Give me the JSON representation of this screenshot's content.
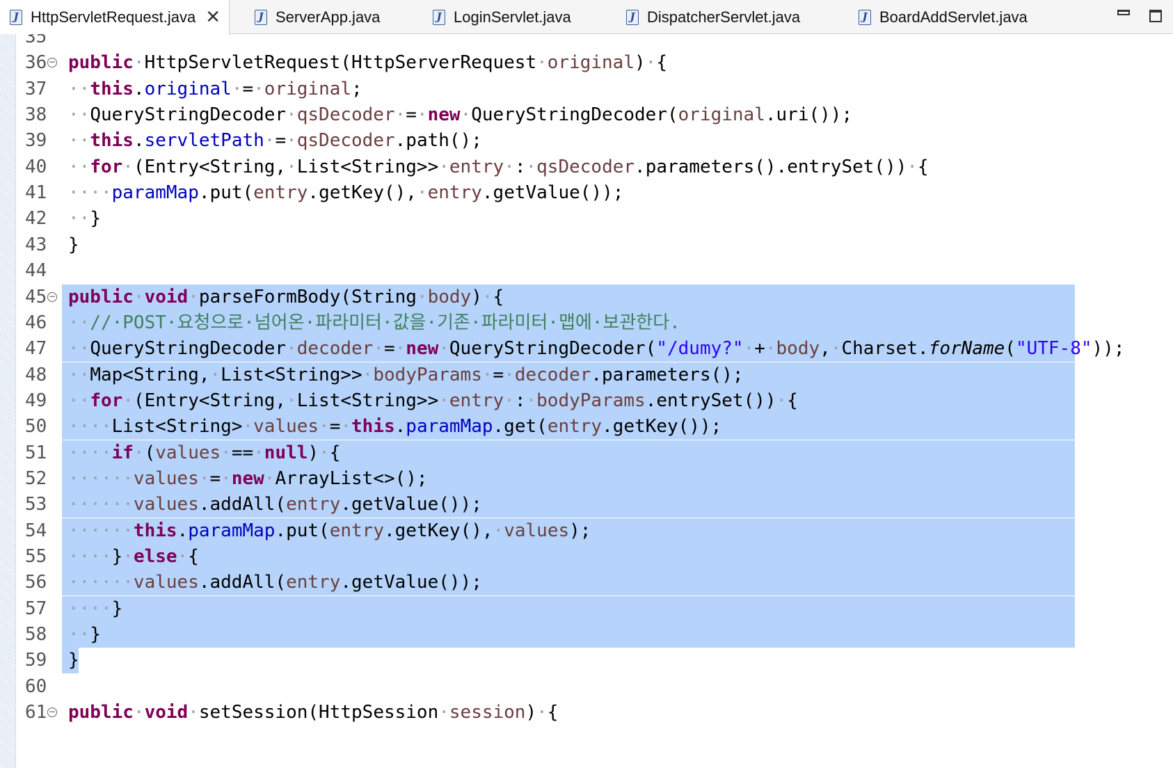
{
  "tabs": [
    {
      "label": "HttpServletRequest.java",
      "active": true
    },
    {
      "label": "ServerApp.java",
      "active": false
    },
    {
      "label": "LoginServlet.java",
      "active": false
    },
    {
      "label": "DispatcherServlet.java",
      "active": false
    },
    {
      "label": "BoardAddServlet.java",
      "active": false
    }
  ],
  "icons": {
    "tab_file": "java-file-icon",
    "tab_close": "close-icon",
    "window_minimize": "minimize-icon",
    "window_maximize": "maximize-icon",
    "fold": "fold-collapse-icon"
  },
  "colors": {
    "keyword": "#7f0055",
    "field": "#0000c0",
    "local_variable": "#6a3e3e",
    "string": "#2a00ff",
    "comment": "#3f7f5f",
    "selection": "#b6d4fb"
  },
  "editor": {
    "selected_lines": [
      45,
      59
    ],
    "lines": [
      {
        "num": "35",
        "tokens": []
      },
      {
        "num": "36",
        "fold": true,
        "tokens": [
          [
            "kw",
            "public"
          ],
          [
            "ws",
            "·"
          ],
          [
            "p",
            "HttpServletRequest(HttpServerRequest"
          ],
          [
            "ws",
            "·"
          ],
          [
            "var",
            "original"
          ],
          [
            "p",
            ")"
          ],
          [
            "ws",
            "·"
          ],
          [
            "p",
            "{"
          ]
        ]
      },
      {
        "num": "37",
        "tokens": [
          [
            "ws",
            "··"
          ],
          [
            "kw",
            "this"
          ],
          [
            "p",
            "."
          ],
          [
            "fld",
            "original"
          ],
          [
            "ws",
            "·"
          ],
          [
            "p",
            "="
          ],
          [
            "ws",
            "·"
          ],
          [
            "var",
            "original"
          ],
          [
            "p",
            ";"
          ]
        ]
      },
      {
        "num": "38",
        "tokens": [
          [
            "ws",
            "··"
          ],
          [
            "p",
            "QueryStringDecoder"
          ],
          [
            "ws",
            "·"
          ],
          [
            "var",
            "qsDecoder"
          ],
          [
            "ws",
            "·"
          ],
          [
            "p",
            "="
          ],
          [
            "ws",
            "·"
          ],
          [
            "kw",
            "new"
          ],
          [
            "ws",
            "·"
          ],
          [
            "p",
            "QueryStringDecoder("
          ],
          [
            "var",
            "original"
          ],
          [
            "p",
            ".uri());"
          ]
        ]
      },
      {
        "num": "39",
        "tokens": [
          [
            "ws",
            "··"
          ],
          [
            "kw",
            "this"
          ],
          [
            "p",
            "."
          ],
          [
            "fld",
            "servletPath"
          ],
          [
            "ws",
            "·"
          ],
          [
            "p",
            "="
          ],
          [
            "ws",
            "·"
          ],
          [
            "var",
            "qsDecoder"
          ],
          [
            "p",
            ".path();"
          ]
        ]
      },
      {
        "num": "40",
        "tokens": [
          [
            "ws",
            "··"
          ],
          [
            "kw",
            "for"
          ],
          [
            "ws",
            "·"
          ],
          [
            "p",
            "(Entry<String,"
          ],
          [
            "ws",
            "·"
          ],
          [
            "p",
            "List<String>>"
          ],
          [
            "ws",
            "·"
          ],
          [
            "var",
            "entry"
          ],
          [
            "ws",
            "·"
          ],
          [
            "p",
            ":"
          ],
          [
            "ws",
            "·"
          ],
          [
            "var",
            "qsDecoder"
          ],
          [
            "p",
            ".parameters().entrySet())"
          ],
          [
            "ws",
            "·"
          ],
          [
            "p",
            "{"
          ]
        ]
      },
      {
        "num": "41",
        "tokens": [
          [
            "ws",
            "····"
          ],
          [
            "fld",
            "paramMap"
          ],
          [
            "p",
            ".put("
          ],
          [
            "var",
            "entry"
          ],
          [
            "p",
            ".getKey(),"
          ],
          [
            "ws",
            "·"
          ],
          [
            "var",
            "entry"
          ],
          [
            "p",
            ".getValue());"
          ]
        ]
      },
      {
        "num": "42",
        "tokens": [
          [
            "ws",
            "··"
          ],
          [
            "p",
            "}"
          ]
        ]
      },
      {
        "num": "43",
        "tokens": [
          [
            "p",
            "}"
          ]
        ]
      },
      {
        "num": "44",
        "tokens": []
      },
      {
        "num": "45",
        "fold": true,
        "tokens": [
          [
            "kw",
            "public"
          ],
          [
            "ws",
            "·"
          ],
          [
            "kw",
            "void"
          ],
          [
            "ws",
            "·"
          ],
          [
            "p",
            "parseFormBody(String"
          ],
          [
            "ws",
            "·"
          ],
          [
            "var",
            "body"
          ],
          [
            "p",
            ")"
          ],
          [
            "ws",
            "·"
          ],
          [
            "p",
            "{"
          ]
        ]
      },
      {
        "num": "46",
        "tokens": [
          [
            "ws",
            "··"
          ],
          [
            "cmt",
            "//·POST·요청으로·넘어온·파라미터·값을·기존·파라미터·맵에·보관한다."
          ]
        ]
      },
      {
        "num": "47",
        "tokens": [
          [
            "ws",
            "··"
          ],
          [
            "p",
            "QueryStringDecoder"
          ],
          [
            "ws",
            "·"
          ],
          [
            "var",
            "decoder"
          ],
          [
            "ws",
            "·"
          ],
          [
            "p",
            "="
          ],
          [
            "ws",
            "·"
          ],
          [
            "kw",
            "new"
          ],
          [
            "ws",
            "·"
          ],
          [
            "p",
            "QueryStringDecoder("
          ],
          [
            "str",
            "\"/dumy?\""
          ],
          [
            "ws",
            "·"
          ],
          [
            "p",
            "+"
          ],
          [
            "ws",
            "·"
          ],
          [
            "var",
            "body"
          ],
          [
            "p",
            ","
          ],
          [
            "ws",
            "·"
          ],
          [
            "p",
            "Charset."
          ],
          [
            "ital",
            "forName"
          ],
          [
            "p",
            "("
          ],
          [
            "str",
            "\"UTF-8\""
          ],
          [
            "p",
            "));"
          ]
        ]
      },
      {
        "num": "48",
        "tokens": [
          [
            "ws",
            "··"
          ],
          [
            "p",
            "Map<String,"
          ],
          [
            "ws",
            "·"
          ],
          [
            "p",
            "List<String>>"
          ],
          [
            "ws",
            "·"
          ],
          [
            "var",
            "bodyParams"
          ],
          [
            "ws",
            "·"
          ],
          [
            "p",
            "="
          ],
          [
            "ws",
            "·"
          ],
          [
            "var",
            "decoder"
          ],
          [
            "p",
            ".parameters();"
          ]
        ]
      },
      {
        "num": "49",
        "tokens": [
          [
            "ws",
            "··"
          ],
          [
            "kw",
            "for"
          ],
          [
            "ws",
            "·"
          ],
          [
            "p",
            "(Entry<String,"
          ],
          [
            "ws",
            "·"
          ],
          [
            "p",
            "List<String>>"
          ],
          [
            "ws",
            "·"
          ],
          [
            "var",
            "entry"
          ],
          [
            "ws",
            "·"
          ],
          [
            "p",
            ":"
          ],
          [
            "ws",
            "·"
          ],
          [
            "var",
            "bodyParams"
          ],
          [
            "p",
            ".entrySet())"
          ],
          [
            "ws",
            "·"
          ],
          [
            "p",
            "{"
          ]
        ]
      },
      {
        "num": "50",
        "tokens": [
          [
            "ws",
            "····"
          ],
          [
            "p",
            "List<String>"
          ],
          [
            "ws",
            "·"
          ],
          [
            "var",
            "values"
          ],
          [
            "ws",
            "·"
          ],
          [
            "p",
            "="
          ],
          [
            "ws",
            "·"
          ],
          [
            "kw",
            "this"
          ],
          [
            "p",
            "."
          ],
          [
            "fld",
            "paramMap"
          ],
          [
            "p",
            ".get("
          ],
          [
            "var",
            "entry"
          ],
          [
            "p",
            ".getKey());"
          ]
        ]
      },
      {
        "num": "51",
        "tokens": [
          [
            "ws",
            "····"
          ],
          [
            "kw",
            "if"
          ],
          [
            "ws",
            "·"
          ],
          [
            "p",
            "("
          ],
          [
            "var",
            "values"
          ],
          [
            "ws",
            "·"
          ],
          [
            "p",
            "=="
          ],
          [
            "ws",
            "·"
          ],
          [
            "kw",
            "null"
          ],
          [
            "p",
            ")"
          ],
          [
            "ws",
            "·"
          ],
          [
            "p",
            "{"
          ]
        ]
      },
      {
        "num": "52",
        "tokens": [
          [
            "ws",
            "······"
          ],
          [
            "var",
            "values"
          ],
          [
            "ws",
            "·"
          ],
          [
            "p",
            "="
          ],
          [
            "ws",
            "·"
          ],
          [
            "kw",
            "new"
          ],
          [
            "ws",
            "·"
          ],
          [
            "p",
            "ArrayList<>();"
          ]
        ]
      },
      {
        "num": "53",
        "tokens": [
          [
            "ws",
            "······"
          ],
          [
            "var",
            "values"
          ],
          [
            "p",
            ".addAll("
          ],
          [
            "var",
            "entry"
          ],
          [
            "p",
            ".getValue());"
          ]
        ]
      },
      {
        "num": "54",
        "tokens": [
          [
            "ws",
            "······"
          ],
          [
            "kw",
            "this"
          ],
          [
            "p",
            "."
          ],
          [
            "fld",
            "paramMap"
          ],
          [
            "p",
            ".put("
          ],
          [
            "var",
            "entry"
          ],
          [
            "p",
            ".getKey(),"
          ],
          [
            "ws",
            "·"
          ],
          [
            "var",
            "values"
          ],
          [
            "p",
            ");"
          ]
        ]
      },
      {
        "num": "55",
        "tokens": [
          [
            "ws",
            "····"
          ],
          [
            "p",
            "}"
          ],
          [
            "ws",
            "·"
          ],
          [
            "kw",
            "else"
          ],
          [
            "ws",
            "·"
          ],
          [
            "p",
            "{"
          ]
        ]
      },
      {
        "num": "56",
        "tokens": [
          [
            "ws",
            "······"
          ],
          [
            "var",
            "values"
          ],
          [
            "p",
            ".addAll("
          ],
          [
            "var",
            "entry"
          ],
          [
            "p",
            ".getValue());"
          ]
        ]
      },
      {
        "num": "57",
        "tokens": [
          [
            "ws",
            "····"
          ],
          [
            "p",
            "}"
          ]
        ]
      },
      {
        "num": "58",
        "tokens": [
          [
            "ws",
            "··"
          ],
          [
            "p",
            "}"
          ]
        ]
      },
      {
        "num": "59",
        "tokens": [
          [
            "p",
            "}"
          ]
        ]
      },
      {
        "num": "60",
        "tokens": []
      },
      {
        "num": "61",
        "fold": true,
        "tokens": [
          [
            "kw",
            "public"
          ],
          [
            "ws",
            "·"
          ],
          [
            "kw",
            "void"
          ],
          [
            "ws",
            "·"
          ],
          [
            "p",
            "setSession(HttpSession"
          ],
          [
            "ws",
            "·"
          ],
          [
            "var",
            "session"
          ],
          [
            "p",
            ")"
          ],
          [
            "ws",
            "·"
          ],
          [
            "p",
            "{"
          ]
        ]
      }
    ]
  }
}
